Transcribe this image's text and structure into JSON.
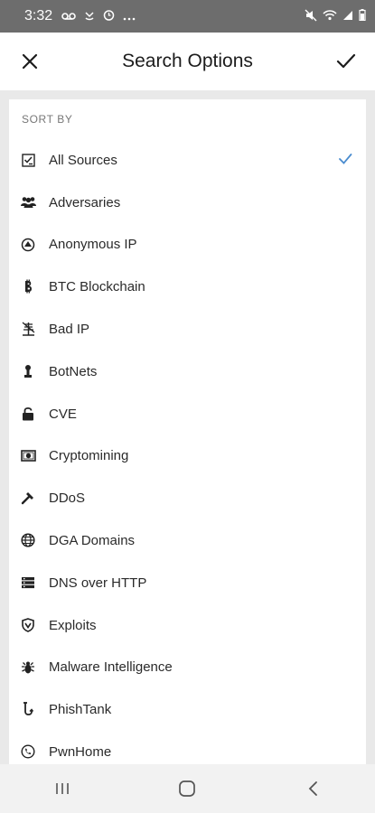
{
  "status_bar": {
    "time": "3:32",
    "left_icons": [
      "voicemail-icon",
      "missed-call-icon",
      "alarm-icon",
      "more-dots-icon"
    ],
    "right_icons": [
      "mute-icon",
      "wifi-icon",
      "signal-icon",
      "battery-icon"
    ]
  },
  "app_bar": {
    "title": "Search Options",
    "close_icon": "close-icon",
    "confirm_icon": "check-icon"
  },
  "sort_by": {
    "header": "SORT BY",
    "selected": "All Sources",
    "items": [
      {
        "label": "All Sources",
        "icon": "list-check-icon"
      },
      {
        "label": "Adversaries",
        "icon": "users-icon"
      },
      {
        "label": "Anonymous IP",
        "icon": "incognito-icon"
      },
      {
        "label": "BTC Blockchain",
        "icon": "bitcoin-icon"
      },
      {
        "label": "Bad IP",
        "icon": "network-warning-icon"
      },
      {
        "label": "BotNets",
        "icon": "robot-icon"
      },
      {
        "label": "CVE",
        "icon": "lock-icon"
      },
      {
        "label": "Cryptomining",
        "icon": "money-icon"
      },
      {
        "label": "DDoS",
        "icon": "hammer-icon"
      },
      {
        "label": "DGA Domains",
        "icon": "globe-icon"
      },
      {
        "label": "DNS over HTTP",
        "icon": "server-icon"
      },
      {
        "label": "Exploits",
        "icon": "shield-icon"
      },
      {
        "label": "Malware Intelligence",
        "icon": "bug-icon"
      },
      {
        "label": "PhishTank",
        "icon": "hook-icon"
      },
      {
        "label": "PwnHome",
        "icon": "phone-icon"
      }
    ]
  },
  "nav_bar": {
    "recents_icon": "recents-icon",
    "home_icon": "home-icon",
    "back_icon": "back-icon"
  },
  "colors": {
    "status_bar": "#6d6d6d",
    "background": "#e9e9e9",
    "check_accent": "#4a8ccf"
  }
}
